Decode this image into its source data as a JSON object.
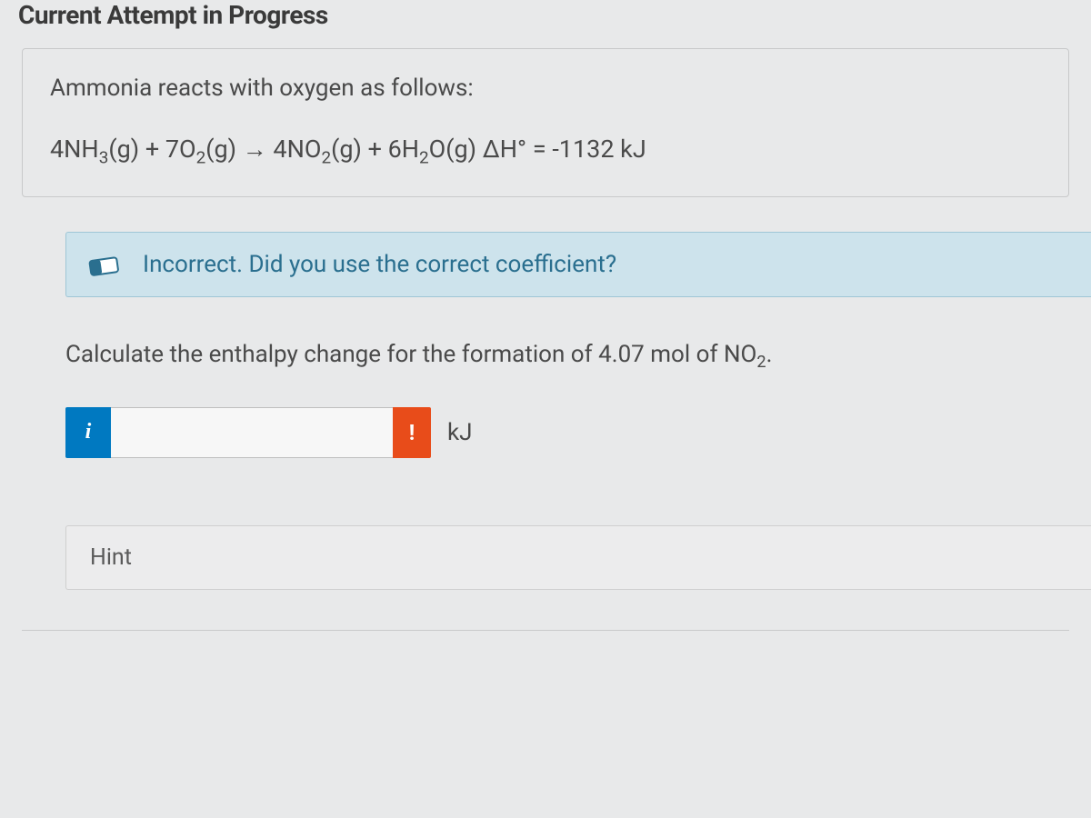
{
  "header_fragment": "Current Attempt in Progress",
  "question": {
    "intro": "Ammonia reacts with oxygen as follows:",
    "equation_parts": {
      "lhs1_coef": "4NH",
      "lhs1_sub": "3",
      "lhs1_state": "(g) + 7O",
      "lhs2_sub": "2",
      "lhs2_state": "(g) → 4NO",
      "rhs1_sub": "2",
      "rhs1_state": "(g) + 6H",
      "rhs2_sub": "2",
      "rhs2_state": "O(g) ΔH° = -1132 kJ"
    }
  },
  "feedback": {
    "text": "Incorrect. Did you use the correct coefficient?"
  },
  "prompt": {
    "before": "Calculate the enthalpy change for the formation of 4.07 mol of NO",
    "sub": "2",
    "after": "."
  },
  "answer": {
    "info_icon": "i",
    "value": "",
    "error_icon": "!",
    "unit": "kJ"
  },
  "hint_label": "Hint"
}
